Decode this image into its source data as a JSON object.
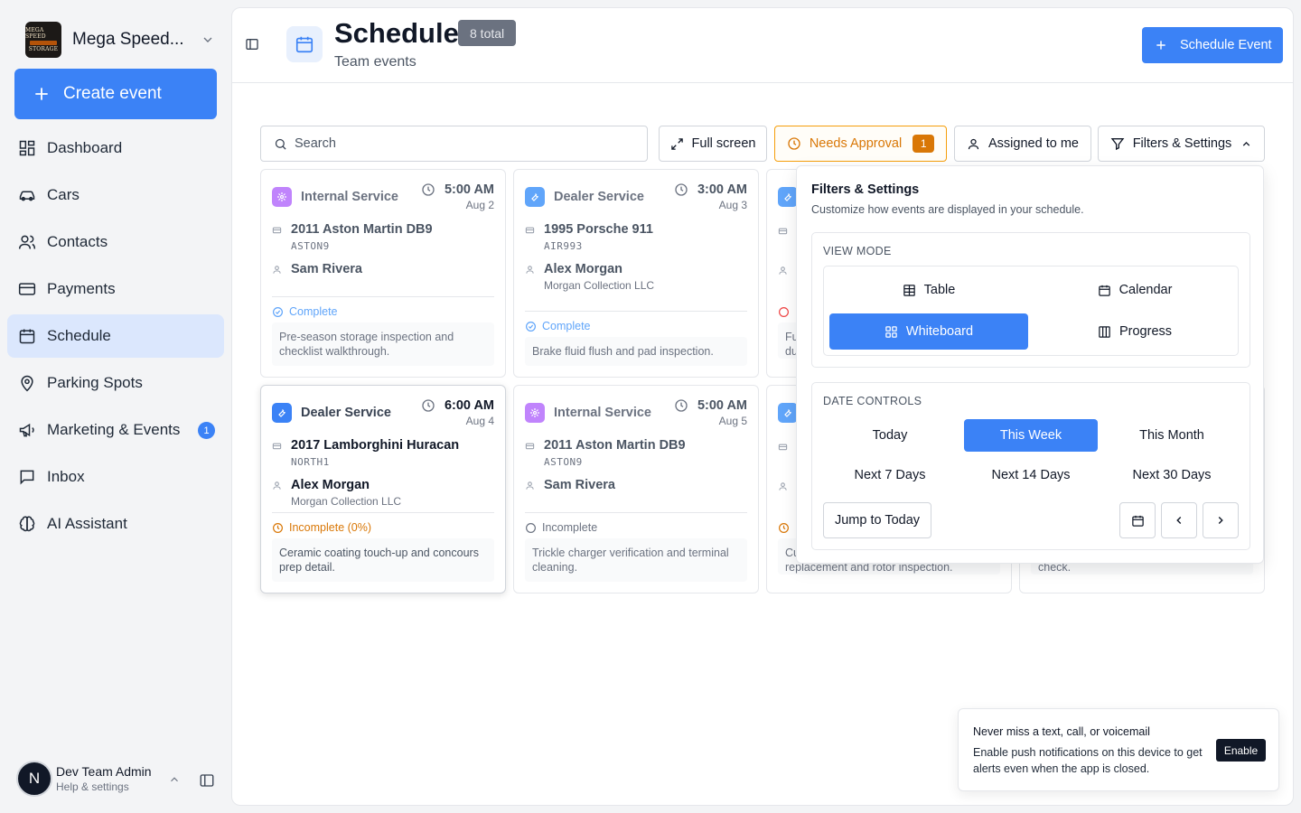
{
  "org": {
    "name": "Mega Speed...",
    "logo_text": [
      "MEGA SPEED",
      "STORAGE"
    ]
  },
  "sidebar": {
    "create_label": "Create event",
    "items": [
      {
        "label": "Dashboard",
        "icon": "dashboard-icon"
      },
      {
        "label": "Cars",
        "icon": "car-icon"
      },
      {
        "label": "Contacts",
        "icon": "contacts-icon"
      },
      {
        "label": "Payments",
        "icon": "credit-card-icon"
      },
      {
        "label": "Schedule",
        "icon": "calendar-icon",
        "active": true
      },
      {
        "label": "Parking Spots",
        "icon": "map-pin-icon"
      },
      {
        "label": "Marketing & Events",
        "icon": "megaphone-icon",
        "badge": "1"
      },
      {
        "label": "Inbox",
        "icon": "inbox-icon"
      },
      {
        "label": "AI Assistant",
        "icon": "brain-icon"
      }
    ]
  },
  "user": {
    "initial": "N",
    "name": "Dev Team Admin",
    "subtitle": "Help & settings"
  },
  "header": {
    "title": "Schedule",
    "badge": "8 total",
    "subtitle": "Team events",
    "action_label": "Schedule Event"
  },
  "toolbar": {
    "search_placeholder": "Search",
    "fullscreen_label": "Full screen",
    "approval_label": "Needs Approval",
    "approval_count": "1",
    "assigned_label": "Assigned to me",
    "filters_label": "Filters & Settings"
  },
  "cards": [
    {
      "type": "Internal Service",
      "time": "5:00 AM",
      "date": "Aug 2",
      "car": "2011 Aston Martin DB9",
      "plate": "ASTON9",
      "person": "Sam Rivera",
      "company": "",
      "status": "Complete",
      "note": "Pre-season storage inspection and checklist walkthrough."
    },
    {
      "type": "Dealer Service",
      "time": "3:00 AM",
      "date": "Aug 3",
      "car": "1995 Porsche 911",
      "plate": "AIR993",
      "person": "Alex Morgan",
      "company": "Morgan Collection LLC",
      "status": "Complete",
      "note": "Brake fluid flush and pad inspection."
    },
    {
      "type": "Dealer Service",
      "time": "6:00 AM",
      "date": "Aug 4",
      "car": "2017 Lamborghini Huracan",
      "plate": "NORTH1",
      "person": "Alex Morgan",
      "company": "Morgan Collection LLC",
      "status": "Incomplete (0%)",
      "note": "Ceramic coating touch-up and concours prep detail."
    },
    {
      "type": "Internal Service",
      "time": "5:00 AM",
      "date": "Aug 5",
      "car": "2011 Aston Martin DB9",
      "plate": "ASTON9",
      "person": "Sam Rivera",
      "company": "",
      "status": "Incomplete",
      "note": "Trickle charger verification and terminal cleaning."
    }
  ],
  "partial_cards": {
    "top_note_fragment_1": "Fu",
    "top_note_fragment_2": "du",
    "bottom_note_fragment": "Cu",
    "bottom_note_tail": "replacement and rotor inspection.",
    "right_note_tail": "check."
  },
  "filters": {
    "title": "Filters & Settings",
    "subtitle": "Customize how events are displayed in your schedule.",
    "view_mode_label": "VIEW MODE",
    "view_modes": [
      "Table",
      "Calendar",
      "Whiteboard",
      "Progress"
    ],
    "selected_view": "Whiteboard",
    "date_controls_label": "DATE CONTROLS",
    "date_ranges": [
      "Today",
      "This Week",
      "This Month",
      "Next 7 Days",
      "Next 14 Days",
      "Next 30 Days"
    ],
    "selected_range": "This Week",
    "jump_label": "Jump to Today"
  },
  "toast": {
    "title": "Never miss a text, call, or voicemail",
    "body": "Enable push notifications on this device to get alerts even when the app is closed.",
    "button": "Enable"
  },
  "colors": {
    "accent": "#3b82f6",
    "warning": "#d97706",
    "internal": "#c084fc",
    "active_nav": "#dbe7fd"
  }
}
